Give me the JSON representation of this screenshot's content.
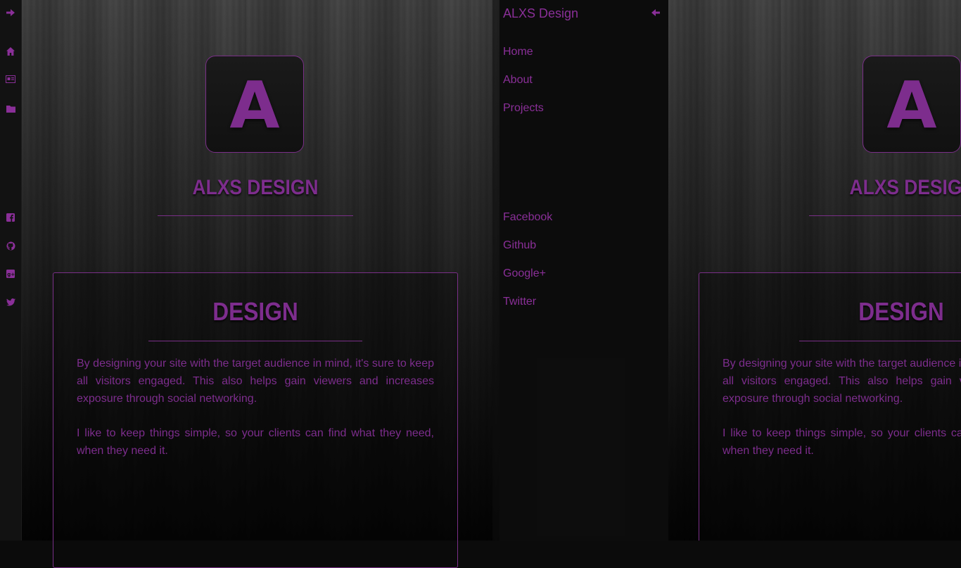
{
  "brand": {
    "logo_letter": "A",
    "title": "ALXS DESIGN"
  },
  "nav": {
    "brand": "ALXS Design",
    "items": [
      {
        "label": "Home"
      },
      {
        "label": "About"
      },
      {
        "label": "Projects"
      }
    ],
    "social": [
      {
        "label": "Facebook"
      },
      {
        "label": "Github"
      },
      {
        "label": "Google+"
      },
      {
        "label": "Twitter"
      }
    ]
  },
  "sidebar": {
    "icons": [
      "arrow-right-icon",
      "home-icon",
      "id-card-icon",
      "folder-icon",
      "facebook-icon",
      "github-icon",
      "google-plus-icon",
      "twitter-icon"
    ]
  },
  "card": {
    "title": "DESIGN",
    "paragraph1": "By designing your site with the target audience in mind, it's sure to keep all visitors engaged. This also helps gain viewers and increases exposure through social networking.",
    "paragraph2": "I like to keep things simple, so your clients can find what they need, when they need it."
  },
  "right_preview": {
    "paragraph1": "By designing your site with the target audience in mind, it's sure to keep all visitors engaged. This also helps gain viewers and increases exposure through social networking.",
    "paragraph2": "I like to keep things simple, so your clients can find what they need, when they need it."
  },
  "colors": {
    "accent": "#8a2f98",
    "background": "#0b0b0b"
  }
}
